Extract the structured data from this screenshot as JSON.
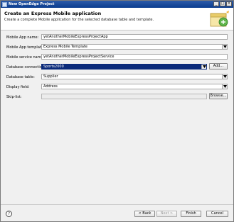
{
  "window": {
    "title": "New OpenEdge Project"
  },
  "banner": {
    "heading": "Create an Express Mobile application",
    "description": "Create a complete Mobile application for the selected database table and template."
  },
  "form": {
    "app_name": {
      "label": "Mobile App name:",
      "value": "yetAnotherMobileExpressProjectApp"
    },
    "app_template": {
      "label": "Mobile App template:",
      "value": "Express Mobile Template"
    },
    "service_name": {
      "label": "Mobile service name:",
      "value": "yetAnotherMobileExpressProjectService"
    },
    "db_connection": {
      "label": "Database connection:",
      "value": "Sports2000",
      "add_label": "Add..."
    },
    "db_table": {
      "label": "Database table:",
      "value": "Supplier"
    },
    "display_field": {
      "label": "Display field:",
      "value": "Address"
    },
    "skip_list": {
      "label": "Skip-list:",
      "value": "",
      "browse_label": "Browse..."
    }
  },
  "footer": {
    "help_label": "?",
    "back_label": "< Back",
    "next_label": "Next >",
    "finish_label": "Finish",
    "cancel_label": "Cancel"
  }
}
